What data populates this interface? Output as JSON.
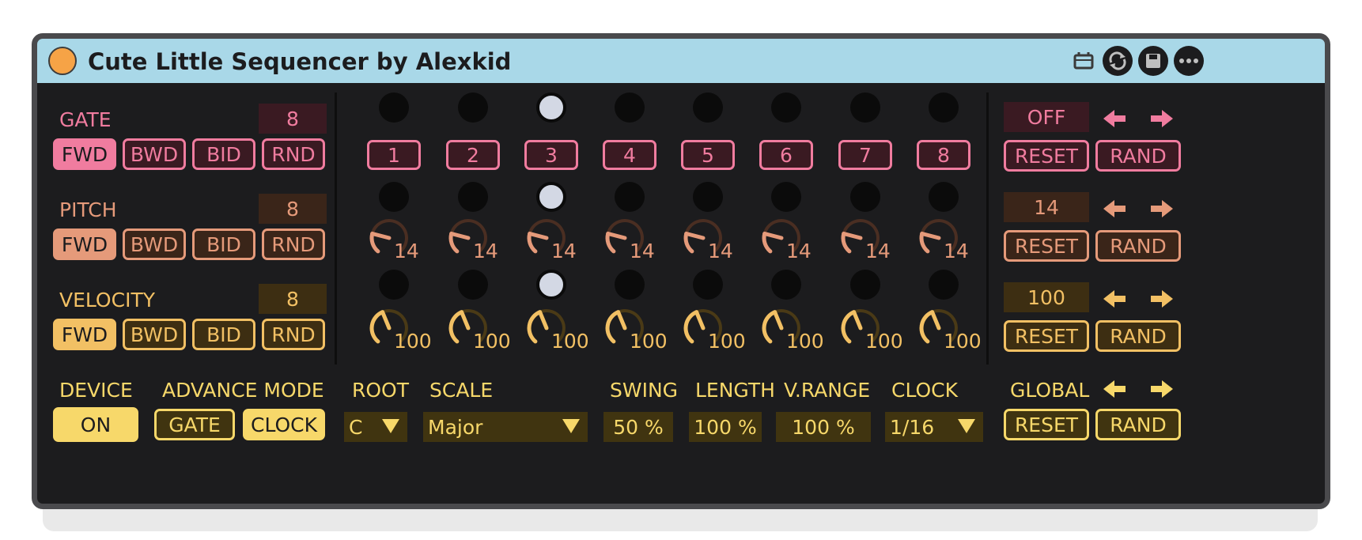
{
  "window": {
    "title": "Cute Little Sequencer by Alexkid"
  },
  "header_icons": [
    "device-icon",
    "sync-icon",
    "save-icon",
    "more-icon"
  ],
  "colors": {
    "gate": "#f07c9f",
    "pitch": "#e59a7a",
    "velocity": "#f2c064",
    "global": "#f7d86a",
    "titlebar": "#a9d8e8"
  },
  "modes": [
    "FWD",
    "BWD",
    "BID",
    "RND"
  ],
  "rows": {
    "gate": {
      "label": "GATE",
      "length": "8",
      "active_mode": "FWD",
      "steps": [
        "1",
        "2",
        "3",
        "4",
        "5",
        "6",
        "7",
        "8"
      ],
      "active_step": 3,
      "value": "OFF",
      "reset": "RESET",
      "rand": "RAND"
    },
    "pitch": {
      "label": "PITCH",
      "length": "8",
      "active_mode": "FWD",
      "knob_values": [
        "14",
        "14",
        "14",
        "14",
        "14",
        "14",
        "14",
        "14"
      ],
      "active_step": 3,
      "value": "14",
      "reset": "RESET",
      "rand": "RAND"
    },
    "velocity": {
      "label": "VELOCITY",
      "length": "8",
      "active_mode": "FWD",
      "knob_values": [
        "100",
        "100",
        "100",
        "100",
        "100",
        "100",
        "100",
        "100"
      ],
      "active_step": 3,
      "value": "100",
      "reset": "RESET",
      "rand": "RAND"
    }
  },
  "bottom": {
    "device_label": "DEVICE",
    "device_state": "ON",
    "advance_label": "ADVANCE MODE",
    "advance_gate": "GATE",
    "advance_clock": "CLOCK",
    "advance_active": "CLOCK",
    "root_label": "ROOT",
    "root_value": "C",
    "scale_label": "SCALE",
    "scale_value": "Major",
    "swing_label": "SWING",
    "swing_value": "50 %",
    "length_label": "LENGTH",
    "length_value": "100 %",
    "vrange_label": "V.RANGE",
    "vrange_value": "100 %",
    "clock_label": "CLOCK",
    "clock_value": "1/16",
    "global_label": "GLOBAL",
    "global_reset": "RESET",
    "global_rand": "RAND"
  }
}
